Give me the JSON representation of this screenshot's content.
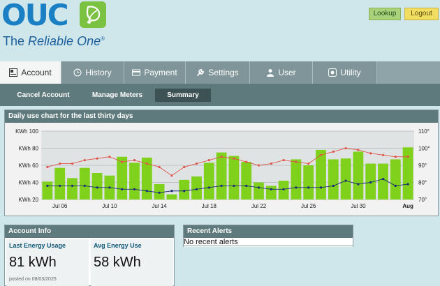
{
  "header": {
    "logo_text": "OUC",
    "tagline_prefix": "The ",
    "tagline_italic": "Reliable One",
    "tagline_mark": "®",
    "lookup_label": "Lookup",
    "logout_label": "Logout"
  },
  "main_tabs": [
    {
      "label": "Account",
      "icon": "account-icon",
      "active": true
    },
    {
      "label": "History",
      "icon": "clock-icon",
      "active": false
    },
    {
      "label": "Payment",
      "icon": "card-icon",
      "active": false
    },
    {
      "label": "Settings",
      "icon": "wrench-icon",
      "active": false
    },
    {
      "label": "User",
      "icon": "user-icon",
      "active": false
    },
    {
      "label": "Utility",
      "icon": "utility-icon",
      "active": false
    }
  ],
  "sub_tabs": [
    {
      "label": "Cancel Account",
      "active": false
    },
    {
      "label": "Manage Meters",
      "active": false
    },
    {
      "label": "Summary",
      "active": true
    }
  ],
  "chart_panel": {
    "title": "Daily use chart for the last thirty days"
  },
  "chart_data": {
    "type": "bar",
    "y_left": {
      "ticks": [
        "KWh 20",
        "KWh 40",
        "KWh 60",
        "KWh 80",
        "KWh 100"
      ],
      "range": [
        20,
        100
      ]
    },
    "y_right": {
      "ticks": [
        "70°",
        "80°",
        "90°",
        "100°",
        "110°"
      ],
      "range": [
        70,
        110
      ]
    },
    "x_tick_labels": [
      "Jul 06",
      "Jul 10",
      "Jul 14",
      "Jul 18",
      "Jul 22",
      "Jul 26",
      "Jul 30",
      "Aug"
    ],
    "categories": [
      "Jul 05",
      "Jul 06",
      "Jul 07",
      "Jul 08",
      "Jul 09",
      "Jul 10",
      "Jul 11",
      "Jul 12",
      "Jul 13",
      "Jul 14",
      "Jul 15",
      "Jul 16",
      "Jul 17",
      "Jul 18",
      "Jul 19",
      "Jul 20",
      "Jul 21",
      "Jul 22",
      "Jul 23",
      "Jul 24",
      "Jul 25",
      "Jul 26",
      "Jul 27",
      "Jul 28",
      "Jul 29",
      "Jul 30",
      "Jul 31",
      "Aug 01",
      "Aug 02",
      "Aug 03"
    ],
    "series": [
      {
        "kind": "bar",
        "axis": "left",
        "color": "#7fd11b",
        "values": [
          41,
          57,
          45,
          57,
          51,
          48,
          70,
          63,
          69,
          38,
          26,
          43,
          47,
          63,
          75,
          71,
          64,
          40,
          36,
          42,
          67,
          60,
          78,
          67,
          68,
          76,
          62,
          62,
          67,
          81
        ]
      },
      {
        "kind": "line",
        "axis": "right",
        "color": "#e0564a",
        "values": [
          89,
          91,
          91,
          93,
          94,
          95,
          92,
          93,
          91,
          89,
          84,
          89,
          91,
          93,
          95,
          94,
          92,
          90,
          91,
          93,
          92,
          91,
          96,
          98,
          100,
          99,
          97,
          96,
          95,
          95
        ]
      },
      {
        "kind": "line",
        "axis": "right",
        "color": "#1b2a7a",
        "values": [
          78,
          78,
          78,
          78,
          77,
          77,
          76,
          76,
          75,
          74,
          75,
          75,
          76,
          77,
          78,
          78,
          78,
          77,
          76,
          76,
          77,
          77,
          77,
          78,
          81,
          79,
          80,
          82,
          78,
          79
        ]
      }
    ],
    "grid": true
  },
  "account_info": {
    "title": "Account Info",
    "last_label": "Last Energy Usage",
    "last_value": "81 kWh",
    "posted": "posted on 08/03/2025",
    "avg_label": "Avg Energy Use",
    "avg_value": "58 kWh"
  },
  "alerts": {
    "title": "Recent Alerts",
    "text": "No recent alerts"
  }
}
